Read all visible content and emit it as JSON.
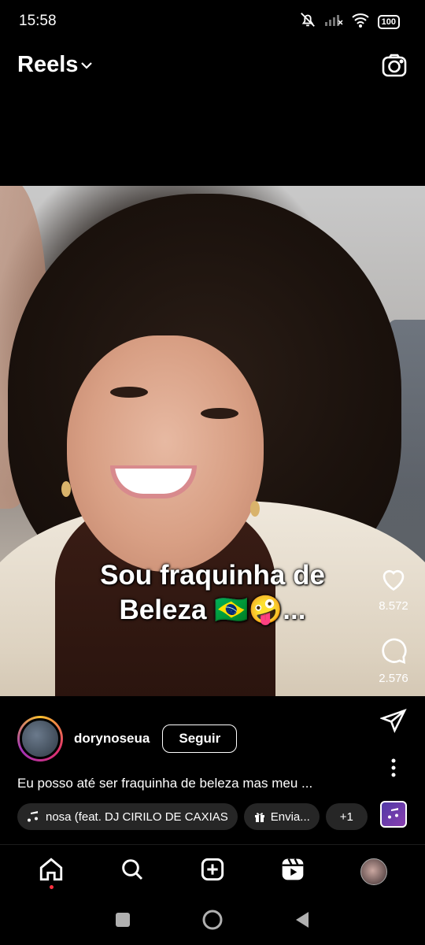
{
  "status_bar": {
    "time": "15:58",
    "battery": "100",
    "icons": [
      "mute-icon",
      "signal-icon",
      "wifi-icon",
      "battery-icon"
    ]
  },
  "header": {
    "title": "Reels",
    "icons": [
      "chevron-down-icon",
      "camera-icon"
    ]
  },
  "video": {
    "caption_line1": "Sou fraquinha de",
    "caption_line2": "Beleza 🇧🇷🤪..."
  },
  "actions": {
    "likes": "8.572",
    "comments": "2.576",
    "icons": [
      "heart-icon",
      "comment-icon",
      "send-icon",
      "more-icon"
    ]
  },
  "post": {
    "username": "dorynoseua",
    "follow_label": "Seguir",
    "caption": "Eu posso até ser fraquinha de beleza mas meu ..."
  },
  "chips": {
    "music": "nosa (feat. DJ CIRILO DE CAXIAS",
    "gift": "Envia...",
    "more": "+1"
  },
  "bottom_nav": {
    "items": [
      "home-icon",
      "search-icon",
      "create-icon",
      "reels-icon",
      "profile-avatar"
    ]
  },
  "system_nav": {
    "items": [
      "recents-button",
      "home-button",
      "back-button"
    ]
  },
  "colors": {
    "background": "#000000",
    "chip_bg": "#262626",
    "notification_dot": "#ff3040"
  }
}
